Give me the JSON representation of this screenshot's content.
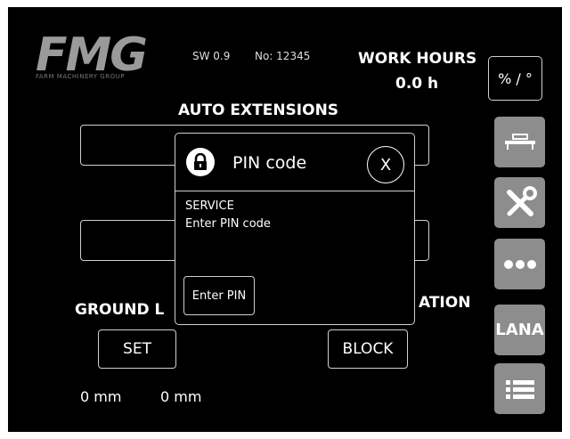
{
  "brand": {
    "logo_text": "FMG",
    "logo_sub": "FARM MACHINERY GROUP"
  },
  "header": {
    "sw_version": "SW 0.9",
    "serial": "No: 12345",
    "work_hours_label": "WORK HOURS",
    "work_hours_value": "0.0 h"
  },
  "main": {
    "auto_extensions_label": "AUTO EXTENSIONS",
    "ground_label_partial": "GROUND L",
    "right_label_partial": "ATION",
    "set_button": "SET",
    "block_button": "BLOCK",
    "readout_1": "0 mm",
    "readout_2": "0 mm"
  },
  "sidebar": {
    "units_button": "% / °",
    "lana_button": "LANA",
    "icons": [
      "boom-icon",
      "tools-icon",
      "more-dots-icon",
      "lana-text",
      "list-icon"
    ]
  },
  "dialog": {
    "title": "PIN code",
    "close_label": "X",
    "line1": "SERVICE",
    "line2": "Enter PIN code",
    "enter_button": "Enter PIN"
  },
  "colors": {
    "background": "#000000",
    "side_button": "#8d8d8d",
    "outline": "#cfcfcf"
  }
}
